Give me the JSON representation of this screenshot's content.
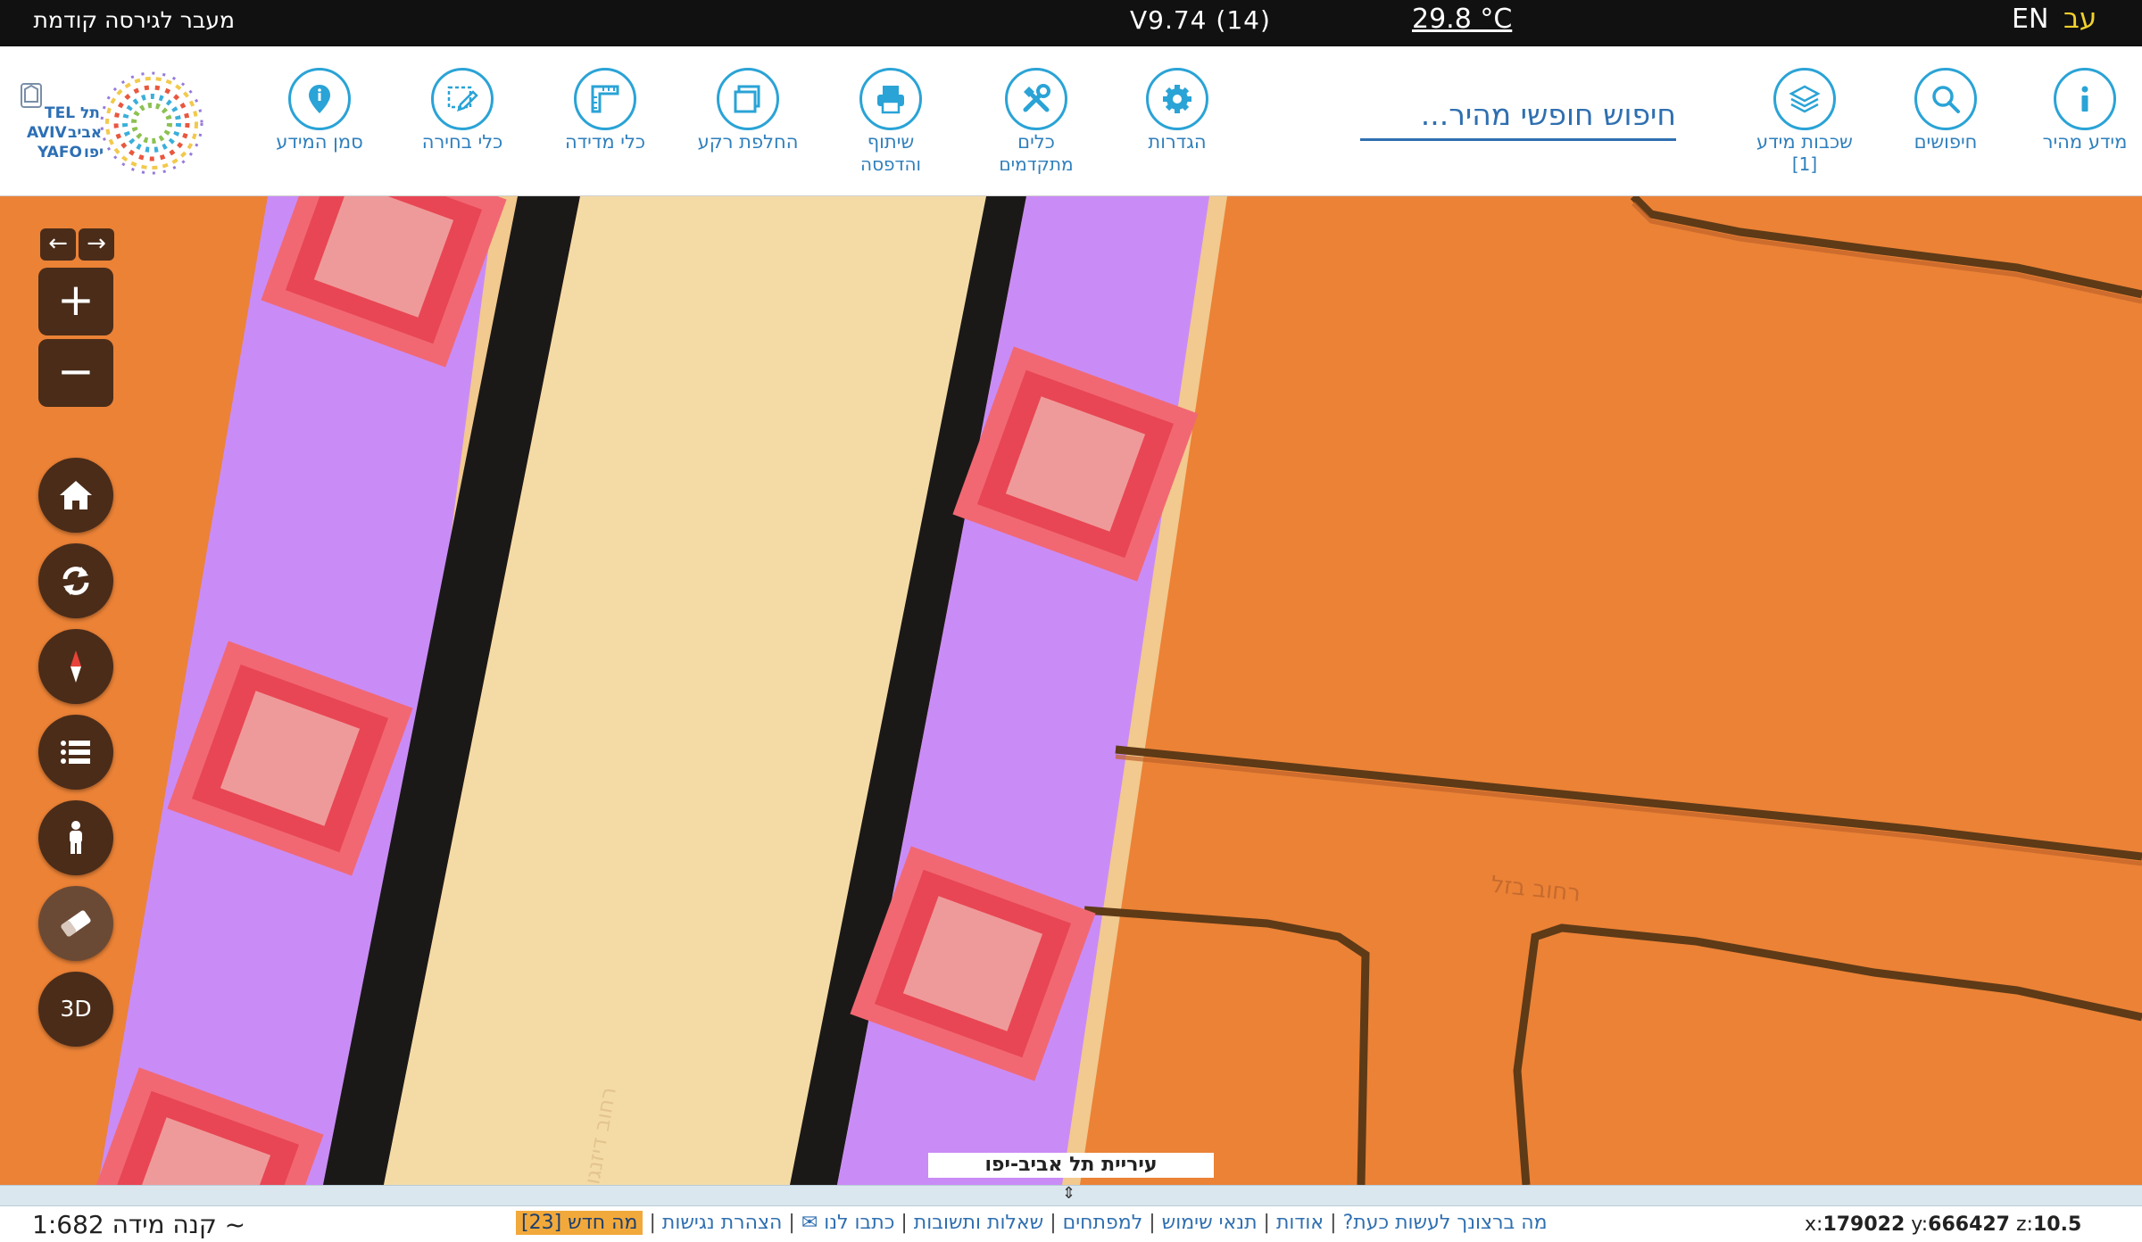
{
  "topbar": {
    "previous_version": "מעבר לגירסה קודמת",
    "version": "V9.74 (14)",
    "temperature": "29.8 °C",
    "lang_en": "EN",
    "lang_he": "עב"
  },
  "toolbar": {
    "tools": [
      {
        "id": "quick-info",
        "label": "מידע מהיר",
        "icon": "info-icon"
      },
      {
        "id": "searches",
        "label": "חיפושים",
        "icon": "search-icon"
      },
      {
        "id": "info-layers",
        "label": "שכבות מידע",
        "sub": "[1]",
        "icon": "layers-icon"
      },
      {
        "id": "settings",
        "label": "הגדרות",
        "icon": "gear-icon"
      },
      {
        "id": "advanced-tools",
        "label": "כלים",
        "sub": "מתקדמים",
        "icon": "tools-icon"
      },
      {
        "id": "share-print",
        "label": "שיתוף",
        "sub": "והדפסה",
        "icon": "print-icon"
      },
      {
        "id": "switch-background",
        "label": "החלפת רקע",
        "icon": "background-icon"
      },
      {
        "id": "measure-tools",
        "label": "כלי מדידה",
        "icon": "ruler-icon"
      },
      {
        "id": "select-tools",
        "label": "כלי בחירה",
        "icon": "select-icon"
      },
      {
        "id": "info-marker",
        "label": "סמן המידע",
        "icon": "marker-icon"
      }
    ],
    "search_placeholder": "חיפוש חופשי מהיר...",
    "logo_text": {
      "line1_en": "TEL",
      "line1_he": "תל",
      "line2_en": "AVIV",
      "line2_he": "אביב",
      "line3_en": "YAFO",
      "line3_he": "יפו"
    }
  },
  "map": {
    "title": "עיריית תל אביב-יפו",
    "street_labels": [
      "רחוב בזל",
      "רחוב דיזנגוף"
    ],
    "controls": {
      "back": "←",
      "forward": "→",
      "zoom_in": "+",
      "zoom_out": "−",
      "label_3d": "3D"
    }
  },
  "bottombar": {
    "scale_label": "קנה מידה ~",
    "scale_value": "1:682",
    "links": [
      "מה ברצונך לעשות כעת?",
      "אודות",
      "תנאי שימוש",
      "למפתחים",
      "שאלות ותשובות",
      "כתבו לנו ✉",
      "הצהרת נגישות"
    ],
    "whats_new": "מה חדש [23]",
    "coords": {
      "x_label": "x:",
      "x": "179022",
      "y_label": "y:",
      "y": "666427",
      "z_label": "z:",
      "z": "10.5"
    }
  },
  "colors": {
    "map_orange": "#eb8236",
    "road_beige": "#f4dba6",
    "lane_purple": "#c98cf6",
    "marker_red": "#e84654",
    "control_brown": "#4a2c19",
    "toolbar_blue": "#2aa3d6"
  }
}
